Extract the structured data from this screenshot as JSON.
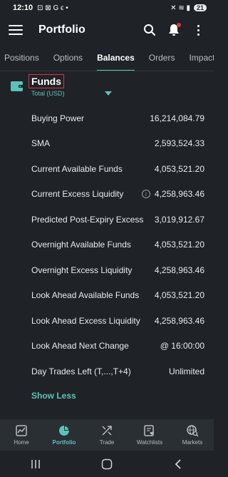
{
  "status": {
    "time": "12:10",
    "left_glyphs": "⊡ ⊠ G ϵ •",
    "right_glyphs": "✕ ≋ ▮",
    "battery": "21"
  },
  "app": {
    "title": "Portfolio"
  },
  "tabs": [
    "Positions",
    "Options",
    "Balances",
    "Orders",
    "Impact Len"
  ],
  "funds": {
    "title": "Funds",
    "subtitle": "Total (USD)"
  },
  "rows": [
    {
      "label": "Buying Power",
      "value": "16,214,084.79"
    },
    {
      "label": "SMA",
      "value": "2,593,524.33"
    },
    {
      "label": "Current Available Funds",
      "value": "4,053,521.20"
    },
    {
      "label": "Current Excess Liquidity",
      "value": "4,258,963.46",
      "info": "i"
    },
    {
      "label": "Predicted Post-Expiry Excess",
      "value": "3,019,912.67"
    },
    {
      "label": "Overnight Available Funds",
      "value": "4,053,521.20"
    },
    {
      "label": "Overnight Excess Liquidity",
      "value": "4,258,963.46"
    },
    {
      "label": "Look Ahead Available Funds",
      "value": "4,053,521.20"
    },
    {
      "label": "Look Ahead Excess Liquidity",
      "value": "4,258,963.46"
    },
    {
      "label": "Look Ahead Next Change",
      "value": "@ 16:00:00"
    },
    {
      "label": "Day Trades Left (T,...,T+4)",
      "value": "Unlimited"
    }
  ],
  "show_less": "Show Less",
  "nav": [
    {
      "label": "Home",
      "icon": "home-chart-icon"
    },
    {
      "label": "Portfolio",
      "icon": "pie-chart-icon"
    },
    {
      "label": "Trade",
      "icon": "trade-arrows-icon"
    },
    {
      "label": "Watchlists",
      "icon": "watchlist-heart-icon"
    },
    {
      "label": "Markets",
      "icon": "globe-search-icon"
    }
  ],
  "colors": {
    "accent": "#5ec2b7",
    "background": "#1f2327",
    "highlight_box": "#e0343b"
  }
}
